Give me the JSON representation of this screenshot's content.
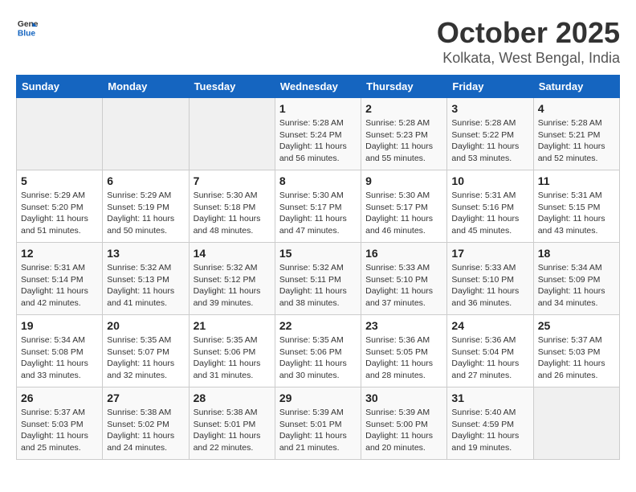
{
  "header": {
    "logo_line1": "General",
    "logo_line2": "Blue",
    "title": "October 2025",
    "subtitle": "Kolkata, West Bengal, India"
  },
  "weekdays": [
    "Sunday",
    "Monday",
    "Tuesday",
    "Wednesday",
    "Thursday",
    "Friday",
    "Saturday"
  ],
  "weeks": [
    [
      {
        "day": "",
        "sunrise": "",
        "sunset": "",
        "daylight": "",
        "empty": true
      },
      {
        "day": "",
        "sunrise": "",
        "sunset": "",
        "daylight": "",
        "empty": true
      },
      {
        "day": "",
        "sunrise": "",
        "sunset": "",
        "daylight": "",
        "empty": true
      },
      {
        "day": "1",
        "sunrise": "Sunrise: 5:28 AM",
        "sunset": "Sunset: 5:24 PM",
        "daylight": "Daylight: 11 hours and 56 minutes."
      },
      {
        "day": "2",
        "sunrise": "Sunrise: 5:28 AM",
        "sunset": "Sunset: 5:23 PM",
        "daylight": "Daylight: 11 hours and 55 minutes."
      },
      {
        "day": "3",
        "sunrise": "Sunrise: 5:28 AM",
        "sunset": "Sunset: 5:22 PM",
        "daylight": "Daylight: 11 hours and 53 minutes."
      },
      {
        "day": "4",
        "sunrise": "Sunrise: 5:28 AM",
        "sunset": "Sunset: 5:21 PM",
        "daylight": "Daylight: 11 hours and 52 minutes."
      }
    ],
    [
      {
        "day": "5",
        "sunrise": "Sunrise: 5:29 AM",
        "sunset": "Sunset: 5:20 PM",
        "daylight": "Daylight: 11 hours and 51 minutes."
      },
      {
        "day": "6",
        "sunrise": "Sunrise: 5:29 AM",
        "sunset": "Sunset: 5:19 PM",
        "daylight": "Daylight: 11 hours and 50 minutes."
      },
      {
        "day": "7",
        "sunrise": "Sunrise: 5:30 AM",
        "sunset": "Sunset: 5:18 PM",
        "daylight": "Daylight: 11 hours and 48 minutes."
      },
      {
        "day": "8",
        "sunrise": "Sunrise: 5:30 AM",
        "sunset": "Sunset: 5:17 PM",
        "daylight": "Daylight: 11 hours and 47 minutes."
      },
      {
        "day": "9",
        "sunrise": "Sunrise: 5:30 AM",
        "sunset": "Sunset: 5:17 PM",
        "daylight": "Daylight: 11 hours and 46 minutes."
      },
      {
        "day": "10",
        "sunrise": "Sunrise: 5:31 AM",
        "sunset": "Sunset: 5:16 PM",
        "daylight": "Daylight: 11 hours and 45 minutes."
      },
      {
        "day": "11",
        "sunrise": "Sunrise: 5:31 AM",
        "sunset": "Sunset: 5:15 PM",
        "daylight": "Daylight: 11 hours and 43 minutes."
      }
    ],
    [
      {
        "day": "12",
        "sunrise": "Sunrise: 5:31 AM",
        "sunset": "Sunset: 5:14 PM",
        "daylight": "Daylight: 11 hours and 42 minutes."
      },
      {
        "day": "13",
        "sunrise": "Sunrise: 5:32 AM",
        "sunset": "Sunset: 5:13 PM",
        "daylight": "Daylight: 11 hours and 41 minutes."
      },
      {
        "day": "14",
        "sunrise": "Sunrise: 5:32 AM",
        "sunset": "Sunset: 5:12 PM",
        "daylight": "Daylight: 11 hours and 39 minutes."
      },
      {
        "day": "15",
        "sunrise": "Sunrise: 5:32 AM",
        "sunset": "Sunset: 5:11 PM",
        "daylight": "Daylight: 11 hours and 38 minutes."
      },
      {
        "day": "16",
        "sunrise": "Sunrise: 5:33 AM",
        "sunset": "Sunset: 5:10 PM",
        "daylight": "Daylight: 11 hours and 37 minutes."
      },
      {
        "day": "17",
        "sunrise": "Sunrise: 5:33 AM",
        "sunset": "Sunset: 5:10 PM",
        "daylight": "Daylight: 11 hours and 36 minutes."
      },
      {
        "day": "18",
        "sunrise": "Sunrise: 5:34 AM",
        "sunset": "Sunset: 5:09 PM",
        "daylight": "Daylight: 11 hours and 34 minutes."
      }
    ],
    [
      {
        "day": "19",
        "sunrise": "Sunrise: 5:34 AM",
        "sunset": "Sunset: 5:08 PM",
        "daylight": "Daylight: 11 hours and 33 minutes."
      },
      {
        "day": "20",
        "sunrise": "Sunrise: 5:35 AM",
        "sunset": "Sunset: 5:07 PM",
        "daylight": "Daylight: 11 hours and 32 minutes."
      },
      {
        "day": "21",
        "sunrise": "Sunrise: 5:35 AM",
        "sunset": "Sunset: 5:06 PM",
        "daylight": "Daylight: 11 hours and 31 minutes."
      },
      {
        "day": "22",
        "sunrise": "Sunrise: 5:35 AM",
        "sunset": "Sunset: 5:06 PM",
        "daylight": "Daylight: 11 hours and 30 minutes."
      },
      {
        "day": "23",
        "sunrise": "Sunrise: 5:36 AM",
        "sunset": "Sunset: 5:05 PM",
        "daylight": "Daylight: 11 hours and 28 minutes."
      },
      {
        "day": "24",
        "sunrise": "Sunrise: 5:36 AM",
        "sunset": "Sunset: 5:04 PM",
        "daylight": "Daylight: 11 hours and 27 minutes."
      },
      {
        "day": "25",
        "sunrise": "Sunrise: 5:37 AM",
        "sunset": "Sunset: 5:03 PM",
        "daylight": "Daylight: 11 hours and 26 minutes."
      }
    ],
    [
      {
        "day": "26",
        "sunrise": "Sunrise: 5:37 AM",
        "sunset": "Sunset: 5:03 PM",
        "daylight": "Daylight: 11 hours and 25 minutes."
      },
      {
        "day": "27",
        "sunrise": "Sunrise: 5:38 AM",
        "sunset": "Sunset: 5:02 PM",
        "daylight": "Daylight: 11 hours and 24 minutes."
      },
      {
        "day": "28",
        "sunrise": "Sunrise: 5:38 AM",
        "sunset": "Sunset: 5:01 PM",
        "daylight": "Daylight: 11 hours and 22 minutes."
      },
      {
        "day": "29",
        "sunrise": "Sunrise: 5:39 AM",
        "sunset": "Sunset: 5:01 PM",
        "daylight": "Daylight: 11 hours and 21 minutes."
      },
      {
        "day": "30",
        "sunrise": "Sunrise: 5:39 AM",
        "sunset": "Sunset: 5:00 PM",
        "daylight": "Daylight: 11 hours and 20 minutes."
      },
      {
        "day": "31",
        "sunrise": "Sunrise: 5:40 AM",
        "sunset": "Sunset: 4:59 PM",
        "daylight": "Daylight: 11 hours and 19 minutes."
      },
      {
        "day": "",
        "sunrise": "",
        "sunset": "",
        "daylight": "",
        "empty": true
      }
    ]
  ]
}
